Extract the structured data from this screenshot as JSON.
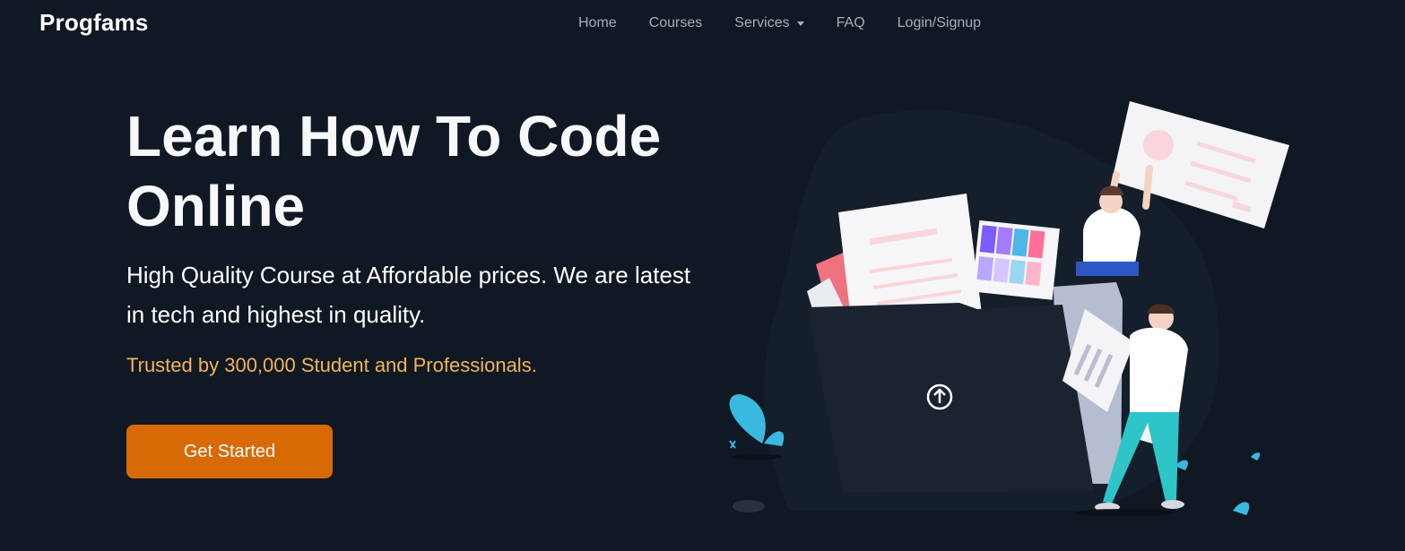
{
  "brand": {
    "name": "Progfams"
  },
  "nav": {
    "items": [
      {
        "label": "Home"
      },
      {
        "label": "Courses"
      },
      {
        "label": "Services",
        "has_dropdown": true
      },
      {
        "label": "FAQ"
      },
      {
        "label": "Login/Signup"
      }
    ]
  },
  "hero": {
    "title": "Learn How To Code Online",
    "subtitle": "High Quality Course at Affordable prices. We are latest in tech and highest in quality.",
    "trusted": "Trusted by 300,000 Student and Professionals.",
    "cta_label": "Get Started"
  },
  "illustration": {
    "icon": "upload-arrow-icon"
  },
  "colors": {
    "background": "#101824",
    "accent": "#d86a06",
    "trusted_text": "#f2b458",
    "nav_text": "#a9afb8"
  }
}
